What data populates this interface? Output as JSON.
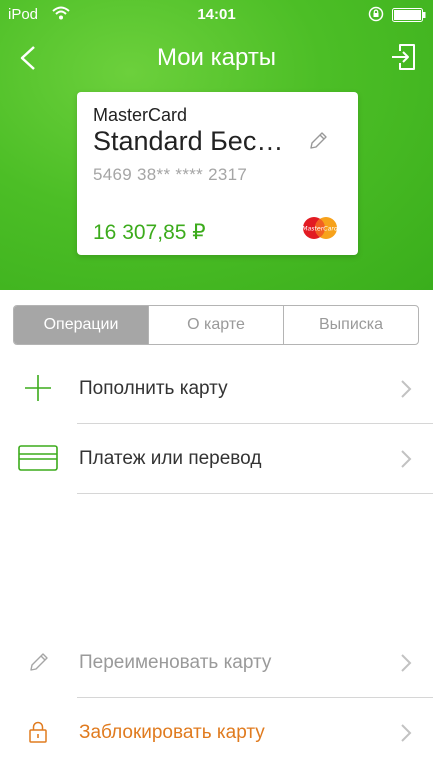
{
  "status_bar": {
    "carrier": "iPod",
    "time": "14:01"
  },
  "nav": {
    "title": "Мои карты",
    "back_icon": "back-chevron-icon",
    "exit_icon": "logout-icon"
  },
  "card": {
    "brand": "MasterCard",
    "name": "Standard Бес…",
    "number": "5469 38** **** 2317",
    "balance": "16 307,85 ₽",
    "logo_text": "MasterCard"
  },
  "tabs": [
    {
      "label": "Операции",
      "active": true
    },
    {
      "label": "О карте",
      "active": false
    },
    {
      "label": "Выписка",
      "active": false
    }
  ],
  "actions": [
    {
      "label": "Пополнить карту",
      "icon": "plus-icon",
      "color": "#333333"
    },
    {
      "label": "Платеж или перевод",
      "icon": "card-transfer-icon",
      "color": "#333333"
    }
  ],
  "card_actions": [
    {
      "label": "Переименовать карту",
      "icon": "pencil-icon",
      "color": "#9a9a9a"
    },
    {
      "label": "Заблокировать карту",
      "icon": "lock-icon",
      "color": "#e07b1f"
    }
  ],
  "colors": {
    "brand_green": "#4cbe26",
    "balance_green": "#3cab1c",
    "warning_orange": "#e07b1f"
  }
}
